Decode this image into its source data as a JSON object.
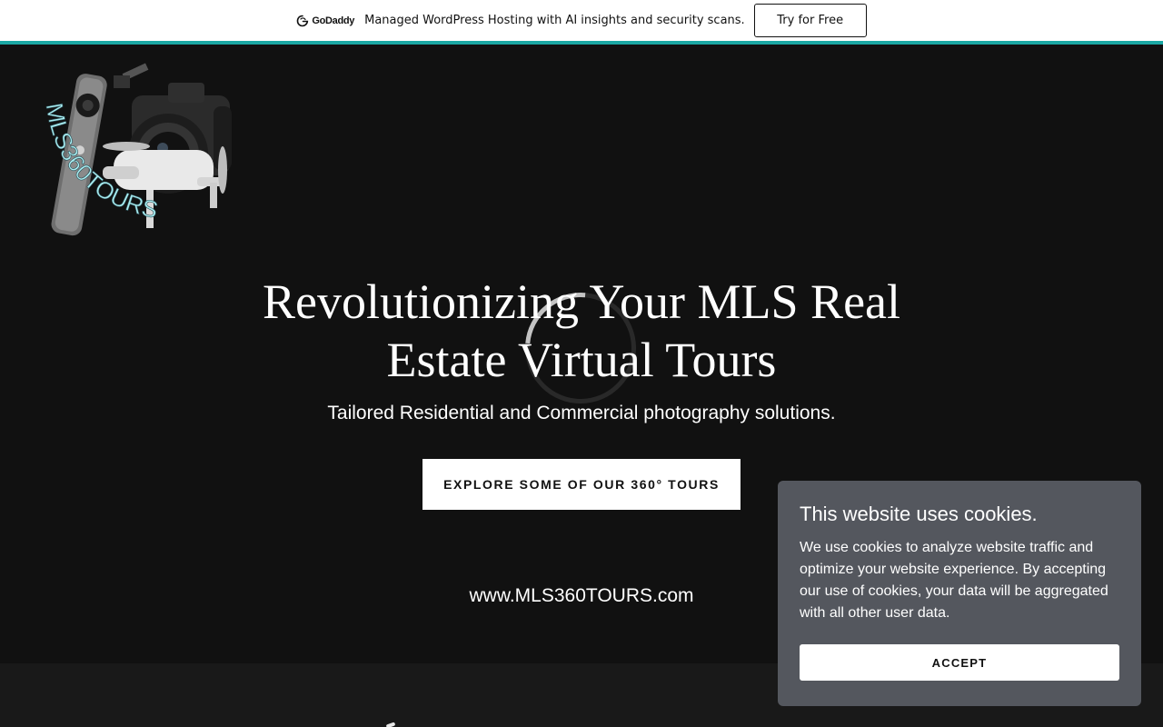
{
  "promo_bar": {
    "brand": "GoDaddy",
    "message": "Managed WordPress Hosting with AI insights and security scans.",
    "button_label": "Try for Free",
    "accent_color": "#1BA8A4"
  },
  "header": {
    "logo_text": "MLS360TOURS",
    "logo_camera_label": "MLS360Tours"
  },
  "hero": {
    "title": "Revolutionizing Your MLS Real Estate Virtual Tours",
    "subtitle": "Tailored Residential and Commercial photography solutions.",
    "cta_label": "EXPLORE SOME OF OUR 360° TOURS",
    "website": "www.MLS360TOURS.com",
    "loading_icon": "spinner-icon"
  },
  "cookie_banner": {
    "title": "This website uses cookies.",
    "body": "We use cookies to analyze website traffic and optimize your website experience. By accepting our use of cookies, your data will be aggregated with all other user data.",
    "accept_label": "ACCEPT"
  },
  "colors": {
    "background": "#111111",
    "cookie_panel": "#54575e",
    "logo_text": "#a8ecf0"
  }
}
